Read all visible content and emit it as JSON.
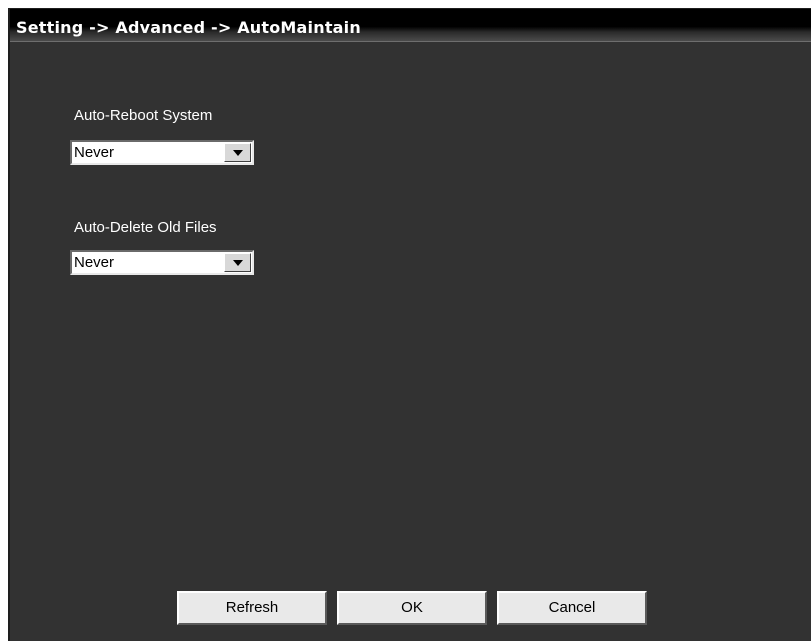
{
  "window": {
    "title": "Setting -> Advanced -> AutoMaintain"
  },
  "auto_reboot": {
    "label": "Auto-Reboot System",
    "selected": "Never"
  },
  "auto_delete": {
    "label": "Auto-Delete Old Files",
    "selected": "Never"
  },
  "buttons": {
    "refresh": "Refresh",
    "ok": "OK",
    "cancel": "Cancel"
  },
  "colors": {
    "panel_background": "#323232",
    "titlebar_background": "#000000",
    "button_face": "#e9e9e9"
  }
}
